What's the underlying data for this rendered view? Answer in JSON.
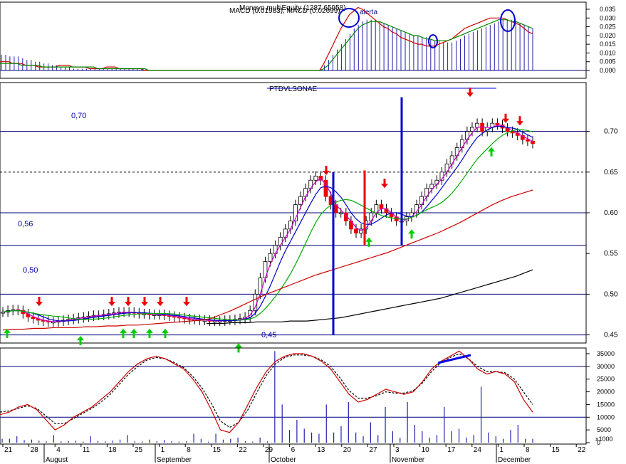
{
  "chart_data": [
    {
      "type": "bar",
      "panel": "macd",
      "title": "MACD (0.01983), MACD (0.02699)",
      "overlap_title": "Moneyo multiEquity (1287.65958)",
      "annotation": "alerta",
      "yticks": [
        "0.035",
        "0.030",
        "0.025",
        "0.020",
        "0.015",
        "0.010",
        "0.005",
        "0.000"
      ],
      "ylim": [
        0,
        0.035
      ],
      "histogram": [
        0.009,
        0.009,
        0.008,
        0.008,
        0.008,
        0.007,
        0.006,
        0.006,
        0.005,
        0.005,
        0.004,
        0.004,
        0.003,
        0.003,
        0.002,
        0.002,
        0.002,
        0.001,
        0.001,
        0.001,
        0.001,
        0.001,
        0.001,
        0.001,
        0.001,
        0.001,
        0.001,
        0.001,
        0.001,
        0.001,
        0.001,
        0.001,
        0.001,
        0.001,
        0.001,
        0.0,
        0.0,
        0.0,
        0.0,
        0.0,
        0.0,
        0.0,
        0.0,
        0.0,
        0.0,
        0.0,
        0.0,
        0.0,
        0.0,
        0.0,
        0.0,
        0.0,
        0.0,
        0.0,
        0.0,
        0.0,
        0.0,
        0.0,
        0.0,
        0.0,
        0.0,
        0.0,
        0.0,
        0.0,
        0.0,
        0.0,
        0.0,
        0.0,
        0.0,
        0.0,
        0.0,
        0.0,
        0.0,
        0.0,
        0.0,
        0.0,
        0.003,
        0.006,
        0.009,
        0.012,
        0.015,
        0.018,
        0.021,
        0.024,
        0.026,
        0.028,
        0.029,
        0.029,
        0.029,
        0.028,
        0.027,
        0.026,
        0.025,
        0.024,
        0.023,
        0.022,
        0.021,
        0.02,
        0.02,
        0.019,
        0.019,
        0.018,
        0.017,
        0.017,
        0.016,
        0.016,
        0.016,
        0.017,
        0.018,
        0.02,
        0.021,
        0.022,
        0.023,
        0.024,
        0.025,
        0.026,
        0.027,
        0.028,
        0.029,
        0.029,
        0.029,
        0.028,
        0.027,
        0.026,
        0.025,
        0.024
      ],
      "red_line": [
        0.005,
        0.005,
        0.005,
        0.004,
        0.004,
        0.004,
        0.003,
        0.003,
        0.003,
        0.002,
        0.002,
        0.002,
        0.002,
        0.002,
        0.003,
        0.003,
        0.003,
        0.002,
        0.002,
        0.002,
        0.002,
        0.001,
        0.001,
        0.001,
        0.001,
        0.002,
        0.002,
        0.002,
        0.001,
        0.001,
        0.001,
        0.001,
        0.001,
        0.001,
        0.0,
        0.0,
        0.0,
        0.0,
        0.0,
        0.0,
        0.0,
        0.0,
        0.0,
        0.0,
        0.0,
        0.0,
        0.0,
        0.0,
        0.0,
        0.0,
        0.0,
        0.0,
        0.0,
        0.0,
        0.0,
        0.0,
        0.0,
        0.0,
        0.0,
        0.0,
        0.0,
        0.0,
        0.0,
        0.0,
        0.0,
        0.0,
        0.0,
        0.0,
        0.0,
        0.0,
        0.0,
        0.0,
        0.0,
        0.0,
        0.0,
        0.0,
        0.004,
        0.009,
        0.014,
        0.019,
        0.024,
        0.028,
        0.032,
        0.034,
        0.036,
        0.035,
        0.033,
        0.031,
        0.029,
        0.027,
        0.025,
        0.024,
        0.022,
        0.021,
        0.019,
        0.018,
        0.017,
        0.016,
        0.015,
        0.015,
        0.014,
        0.014,
        0.014,
        0.015,
        0.016,
        0.017,
        0.018,
        0.02,
        0.022,
        0.024,
        0.025,
        0.026,
        0.027,
        0.028,
        0.029,
        0.03,
        0.03,
        0.03,
        0.03,
        0.029,
        0.028,
        0.027,
        0.026,
        0.024,
        0.022,
        0.021
      ],
      "green_line": [
        0.004,
        0.004,
        0.004,
        0.004,
        0.004,
        0.003,
        0.003,
        0.003,
        0.003,
        0.003,
        0.002,
        0.002,
        0.002,
        0.002,
        0.002,
        0.002,
        0.002,
        0.002,
        0.002,
        0.002,
        0.002,
        0.002,
        0.002,
        0.001,
        0.001,
        0.001,
        0.001,
        0.001,
        0.001,
        0.001,
        0.001,
        0.001,
        0.001,
        0.001,
        0.001,
        0.0,
        0.0,
        0.0,
        0.0,
        0.0,
        0.0,
        0.0,
        0.0,
        0.0,
        0.0,
        0.0,
        0.0,
        0.0,
        0.0,
        0.0,
        0.0,
        0.0,
        0.0,
        0.0,
        0.0,
        0.0,
        0.0,
        0.0,
        0.0,
        0.0,
        0.0,
        0.0,
        0.0,
        0.0,
        0.0,
        0.0,
        0.0,
        0.0,
        0.0,
        0.0,
        0.0,
        0.0,
        0.0,
        0.0,
        0.0,
        0.0,
        0.001,
        0.003,
        0.006,
        0.009,
        0.012,
        0.015,
        0.018,
        0.021,
        0.024,
        0.026,
        0.027,
        0.028,
        0.028,
        0.028,
        0.027,
        0.026,
        0.025,
        0.024,
        0.023,
        0.022,
        0.021,
        0.02,
        0.02,
        0.019,
        0.018,
        0.018,
        0.017,
        0.017,
        0.017,
        0.017,
        0.018,
        0.019,
        0.02,
        0.021,
        0.022,
        0.023,
        0.024,
        0.025,
        0.026,
        0.027,
        0.028,
        0.029,
        0.029,
        0.029,
        0.028,
        0.028,
        0.027,
        0.026,
        0.025,
        0.024
      ]
    },
    {
      "type": "candlestick",
      "panel": "price",
      "title": "PTDVLSONAE",
      "yticks": [
        "0.70",
        "0.65",
        "0.60",
        "0.55",
        "0.50",
        "0.45"
      ],
      "ylim": [
        0.44,
        0.76
      ],
      "annotations": [
        "0,70",
        "0,56",
        "0,50",
        "0,45"
      ],
      "hlines": [
        0.7,
        0.6,
        0.56,
        0.5,
        0.45
      ],
      "dashed_hline": 0.65,
      "close": [
        0.478,
        0.48,
        0.481,
        0.48,
        0.476,
        0.472,
        0.47,
        0.468,
        0.467,
        0.466,
        0.466,
        0.467,
        0.468,
        0.469,
        0.47,
        0.471,
        0.472,
        0.473,
        0.474,
        0.474,
        0.475,
        0.476,
        0.477,
        0.478,
        0.478,
        0.478,
        0.477,
        0.476,
        0.476,
        0.475,
        0.475,
        0.475,
        0.474,
        0.473,
        0.472,
        0.471,
        0.47,
        0.469,
        0.469,
        0.468,
        0.468,
        0.467,
        0.467,
        0.467,
        0.468,
        0.468,
        0.469,
        0.47,
        0.472,
        0.48,
        0.5,
        0.52,
        0.54,
        0.55,
        0.56,
        0.57,
        0.58,
        0.59,
        0.61,
        0.62,
        0.63,
        0.64,
        0.645,
        0.64,
        0.62,
        0.61,
        0.6,
        0.6,
        0.59,
        0.58,
        0.575,
        0.58,
        0.59,
        0.6,
        0.61,
        0.605,
        0.6,
        0.595,
        0.59,
        0.59,
        0.595,
        0.6,
        0.61,
        0.62,
        0.63,
        0.635,
        0.64,
        0.65,
        0.66,
        0.67,
        0.68,
        0.69,
        0.7,
        0.705,
        0.71,
        0.7,
        0.705,
        0.71,
        0.708,
        0.704,
        0.7,
        0.698,
        0.695,
        0.69,
        0.688,
        0.685
      ],
      "lines": [
        {
          "color": "#cc0000",
          "values": [
            0.456,
            0.457,
            0.457,
            0.458,
            0.458,
            0.459,
            0.459,
            0.459,
            0.46,
            0.46,
            0.461,
            0.461,
            0.462,
            0.462,
            0.463,
            0.464,
            0.465,
            0.466,
            0.467,
            0.468,
            0.47,
            0.475,
            0.48,
            0.486,
            0.492,
            0.498,
            0.503,
            0.508,
            0.513,
            0.518,
            0.523,
            0.527,
            0.531,
            0.535,
            0.539,
            0.543,
            0.547,
            0.551,
            0.556,
            0.561,
            0.566,
            0.571,
            0.576,
            0.582,
            0.588,
            0.595,
            0.602,
            0.609,
            0.615,
            0.62,
            0.624,
            0.628
          ]
        },
        {
          "color": "#000000",
          "values": [
            0.464,
            0.464,
            0.464,
            0.465,
            0.465,
            0.465,
            0.466,
            0.466,
            0.466,
            0.466,
            0.467,
            0.467,
            0.467,
            0.468,
            0.469,
            0.47,
            0.471,
            0.473,
            0.475,
            0.477,
            0.479,
            0.481,
            0.483,
            0.485,
            0.487,
            0.489,
            0.491,
            0.493,
            0.495,
            0.498,
            0.501,
            0.504,
            0.507,
            0.51,
            0.513,
            0.516,
            0.519,
            0.522,
            0.526,
            0.53
          ]
        }
      ]
    },
    {
      "type": "line",
      "panel": "oscillator",
      "yticks": [
        "35000",
        "30000",
        "25000",
        "20000",
        "15000",
        "10000",
        "5000",
        "0"
      ],
      "ylabel": "x1000",
      "ylim": [
        0,
        35000
      ],
      "xlabels": [
        "21",
        "28",
        "4",
        "11",
        "18",
        "25",
        "1",
        "8",
        "15",
        "22",
        "29",
        "6",
        "13",
        "20",
        "27",
        "3",
        "10",
        "17",
        "24",
        "1",
        "8",
        "15",
        "22"
      ],
      "months": [
        "August",
        "September",
        "October",
        "November",
        "December"
      ],
      "red_line": [
        11000,
        12000,
        14000,
        15000,
        13000,
        9000,
        5000,
        7000,
        10000,
        12000,
        14000,
        17000,
        20000,
        24000,
        28000,
        31000,
        33000,
        34000,
        33000,
        31000,
        29000,
        25000,
        20000,
        13000,
        5000,
        4000,
        8000,
        15000,
        22000,
        28000,
        32000,
        34000,
        35000,
        35000,
        34000,
        32000,
        29000,
        24000,
        19000,
        16000,
        17000,
        19000,
        21000,
        20000,
        19000,
        20000,
        24000,
        29000,
        32000,
        34000,
        36000,
        33000,
        29000,
        27000,
        28000,
        27000,
        24000,
        17000,
        12000
      ],
      "black_dashed": [
        12000,
        12500,
        13500,
        14500,
        13500,
        10500,
        7500,
        7500,
        9500,
        11500,
        13500,
        16000,
        19000,
        23000,
        27000,
        30000,
        32500,
        33500,
        33000,
        31500,
        29500,
        26000,
        21500,
        15500,
        8500,
        6000,
        8000,
        13000,
        20000,
        26500,
        31000,
        33500,
        34500,
        34500,
        34000,
        32500,
        30000,
        25500,
        20500,
        17500,
        17500,
        18500,
        20000,
        19500,
        19500,
        20500,
        23500,
        28000,
        31500,
        33500,
        35000,
        33000,
        30000,
        28000,
        28000,
        27500,
        25000,
        20000,
        15000
      ],
      "volume": [
        1500,
        1500,
        2500,
        1000,
        1200,
        800,
        500,
        3000,
        500,
        600,
        800,
        400,
        2500,
        700,
        500,
        800,
        1200,
        3000,
        500,
        500,
        1200,
        600,
        1000,
        500,
        400,
        600,
        3500,
        1500,
        400,
        3500,
        1200,
        1500,
        2000,
        600,
        400,
        2000,
        500,
        36000,
        15000,
        5000,
        9000,
        5500,
        4000,
        3500,
        15000,
        4000,
        6500,
        16000,
        4000,
        2500,
        8000,
        3000,
        14000,
        4500,
        2000,
        16000,
        7000,
        4500,
        2000,
        3000,
        14000,
        4500,
        5500,
        2000,
        3000,
        22000,
        4000,
        2500,
        1500,
        5000,
        7000,
        1500,
        1500
      ]
    }
  ]
}
